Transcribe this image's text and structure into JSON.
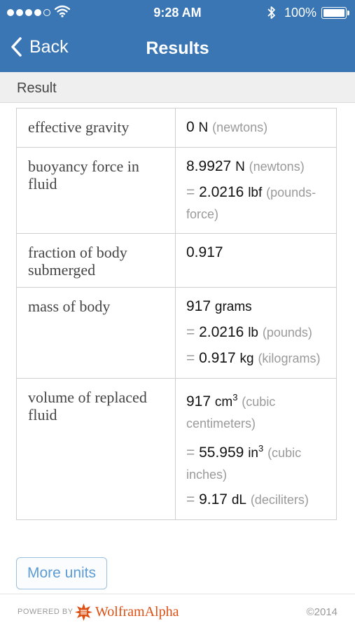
{
  "status_bar": {
    "time": "9:28 AM",
    "battery": "100%"
  },
  "nav": {
    "back_label": "Back",
    "title": "Results"
  },
  "section": {
    "title": "Result"
  },
  "rows": [
    {
      "label": "effective gravity",
      "values": [
        {
          "prefix": "",
          "number": "0",
          "unit": "N",
          "desc": "(newtons)"
        }
      ]
    },
    {
      "label": "buoyancy force in fluid",
      "values": [
        {
          "prefix": "",
          "number": "8.9927",
          "unit": "N",
          "desc": "(newtons)"
        },
        {
          "prefix": "=",
          "number": "2.0216",
          "unit": "lbf",
          "desc": "(pounds-force)"
        }
      ]
    },
    {
      "label": "fraction of body submerged",
      "values": [
        {
          "prefix": "",
          "number": "0.917",
          "unit": "",
          "desc": ""
        }
      ]
    },
    {
      "label": "mass of body",
      "values": [
        {
          "prefix": "",
          "number": "917",
          "unit": "grams",
          "desc": ""
        },
        {
          "prefix": "=",
          "number": "2.0216",
          "unit": "lb",
          "desc": "(pounds)"
        },
        {
          "prefix": "=",
          "number": "0.917",
          "unit": "kg",
          "desc": "(kilograms)"
        }
      ]
    },
    {
      "label": "volume of replaced fluid",
      "values": [
        {
          "prefix": "",
          "number": "917",
          "unit": "cm",
          "sup": "3",
          "desc": "(cubic centimeters)"
        },
        {
          "prefix": "=",
          "number": "55.959",
          "unit": "in",
          "sup": "3",
          "desc": "(cubic inches)"
        },
        {
          "prefix": "=",
          "number": "9.17",
          "unit": "dL",
          "desc": "(deciliters)"
        }
      ]
    }
  ],
  "actions": {
    "more_units": "More units"
  },
  "footer": {
    "powered_by": "POWERED BY",
    "brand": "WolframAlpha",
    "copyright": "©2014"
  },
  "colors": {
    "nav_bar": "#3a76b4",
    "brand_orange": "#dd4f12",
    "link_blue": "#5d9bd5"
  }
}
